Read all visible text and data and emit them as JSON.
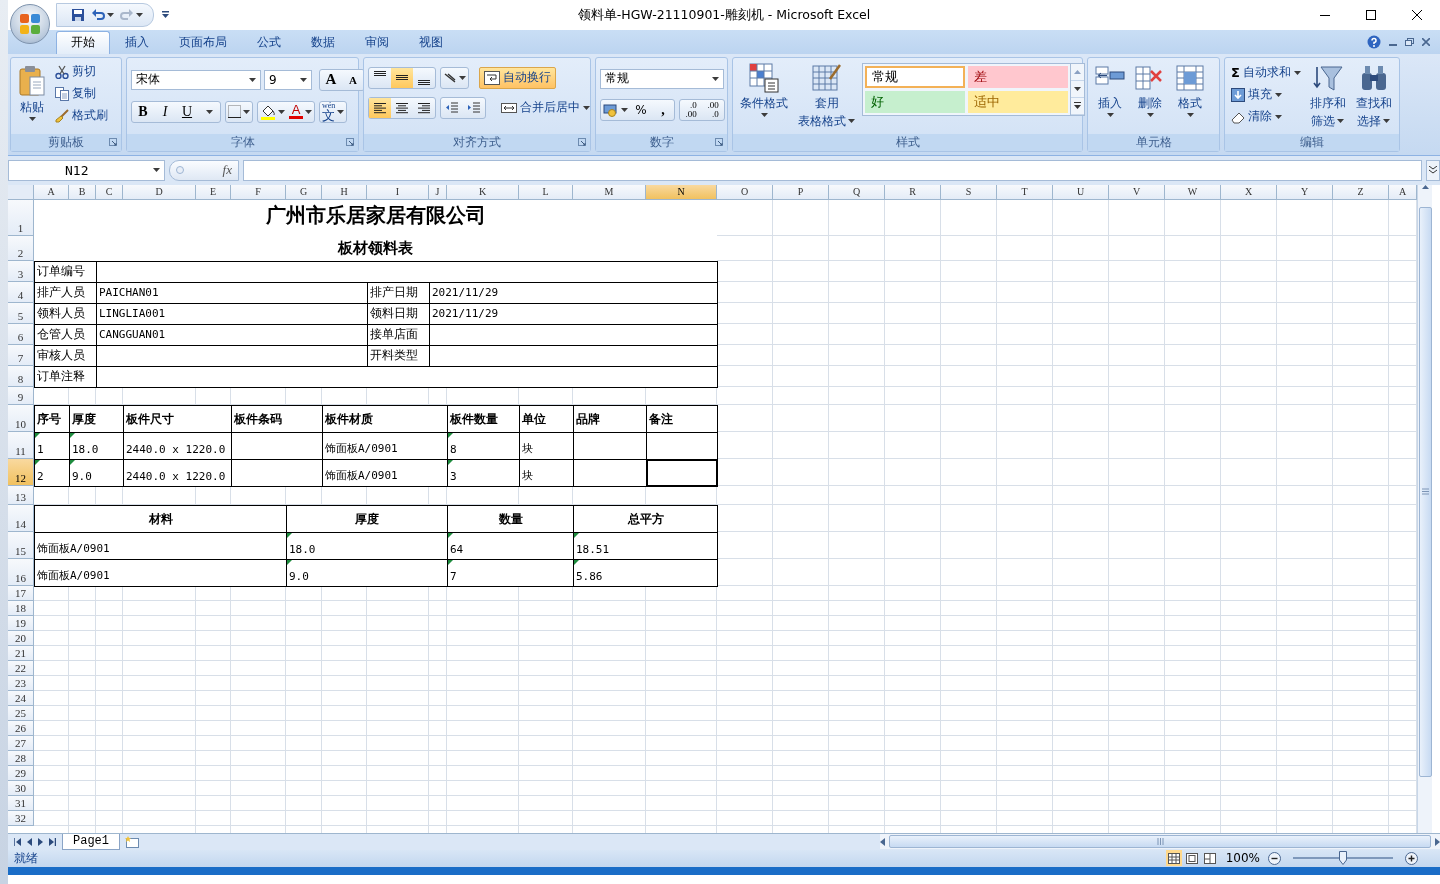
{
  "window": {
    "title": "领料单-HGW-21110901-雕刻机 - Microsoft Excel"
  },
  "tabs": [
    {
      "label": "开始",
      "selected": true
    },
    {
      "label": "插入",
      "selected": false
    },
    {
      "label": "页面布局",
      "selected": false
    },
    {
      "label": "公式",
      "selected": false
    },
    {
      "label": "数据",
      "selected": false
    },
    {
      "label": "审阅",
      "selected": false
    },
    {
      "label": "视图",
      "selected": false
    }
  ],
  "ribbon": {
    "clipboard": {
      "label": "剪贴板",
      "paste": "粘贴",
      "cut": "剪切",
      "copy": "复制",
      "format_painter": "格式刷"
    },
    "font": {
      "label": "字体",
      "font_name": "宋体",
      "font_size": "9",
      "grow": "A",
      "shrink": "A",
      "bold": "B",
      "italic": "I",
      "underline": "U",
      "font_color": "A",
      "phonetic_top": "wén",
      "phonetic": "文"
    },
    "alignment": {
      "label": "对齐方式",
      "vertical": [
        {
          "selected": false
        },
        {
          "selected": true
        },
        {
          "selected": false
        }
      ],
      "horizontal": [
        {
          "selected": true
        },
        {
          "selected": false
        },
        {
          "selected": false
        }
      ],
      "wrap_text": {
        "label": "自动换行",
        "selected": true
      },
      "merge": "合并后居中"
    },
    "number": {
      "label": "数字",
      "format": "常规",
      "percent": "%",
      "comma": ",",
      "decimal_increase": [
        ".0",
        ".00"
      ],
      "decimal_decrease": [
        ".00",
        ".0"
      ]
    },
    "styles": {
      "label": "样式",
      "conditional": "条件格式",
      "table_format": [
        "套用",
        "表格格式"
      ],
      "cell_styles": [
        {
          "text": "常规",
          "kind": "normal",
          "selected": true
        },
        {
          "text": "差",
          "kind": "bad",
          "selected": false
        },
        {
          "text": "好",
          "kind": "good",
          "selected": false
        },
        {
          "text": "适中",
          "kind": "neutral",
          "selected": false
        }
      ]
    },
    "cells": {
      "label": "单元格",
      "insert": "插入",
      "delete": "删除",
      "format": "格式"
    },
    "editing": {
      "label": "编辑",
      "autosum_symbol": "Σ",
      "autosum": "自动求和",
      "fill": "填充",
      "clear": "清除",
      "sort_filter": [
        "排序和",
        "筛选"
      ],
      "find_select": [
        "查找和",
        "选择"
      ]
    }
  },
  "formula_bar": {
    "name_box": "N12",
    "function_label": "fx"
  },
  "columns": [
    {
      "label": "A",
      "selected": false
    },
    {
      "label": "B",
      "selected": false
    },
    {
      "label": "C",
      "selected": false
    },
    {
      "label": "D",
      "selected": false
    },
    {
      "label": "E",
      "selected": false
    },
    {
      "label": "F",
      "selected": false
    },
    {
      "label": "G",
      "selected": false
    },
    {
      "label": "H",
      "selected": false
    },
    {
      "label": "I",
      "selected": false
    },
    {
      "label": "J",
      "selected": false
    },
    {
      "label": "K",
      "selected": false
    },
    {
      "label": "L",
      "selected": false
    },
    {
      "label": "M",
      "selected": false
    },
    {
      "label": "N",
      "selected": true
    },
    {
      "label": "O",
      "selected": false
    },
    {
      "label": "P",
      "selected": false
    },
    {
      "label": "Q",
      "selected": false
    },
    {
      "label": "R",
      "selected": false
    },
    {
      "label": "S",
      "selected": false
    },
    {
      "label": "T",
      "selected": false
    },
    {
      "label": "U",
      "selected": false
    },
    {
      "label": "V",
      "selected": false
    },
    {
      "label": "W",
      "selected": false
    },
    {
      "label": "X",
      "selected": false
    },
    {
      "label": "Y",
      "selected": false
    },
    {
      "label": "Z",
      "selected": false
    },
    {
      "label": "A",
      "selected": false
    }
  ],
  "rows": [
    {
      "label": "1",
      "selected": false
    },
    {
      "label": "2",
      "selected": false
    },
    {
      "label": "3",
      "selected": false
    },
    {
      "label": "4",
      "selected": false
    },
    {
      "label": "5",
      "selected": false
    },
    {
      "label": "6",
      "selected": false
    },
    {
      "label": "7",
      "selected": false
    },
    {
      "label": "8",
      "selected": false
    },
    {
      "label": "9",
      "selected": false
    },
    {
      "label": "10",
      "selected": false
    },
    {
      "label": "11",
      "selected": false
    },
    {
      "label": "12",
      "selected": true
    },
    {
      "label": "13",
      "selected": false
    },
    {
      "label": "14",
      "selected": false
    },
    {
      "label": "15",
      "selected": false
    },
    {
      "label": "16",
      "selected": false
    },
    {
      "label": "17",
      "selected": false
    },
    {
      "label": "18",
      "selected": false
    },
    {
      "label": "19",
      "selected": false
    },
    {
      "label": "20",
      "selected": false
    },
    {
      "label": "21",
      "selected": false
    },
    {
      "label": "22",
      "selected": false
    },
    {
      "label": "23",
      "selected": false
    },
    {
      "label": "24",
      "selected": false
    },
    {
      "label": "25",
      "selected": false
    },
    {
      "label": "26",
      "selected": false
    },
    {
      "label": "27",
      "selected": false
    },
    {
      "label": "28",
      "selected": false
    },
    {
      "label": "29",
      "selected": false
    },
    {
      "label": "30",
      "selected": false
    },
    {
      "label": "31",
      "selected": false
    },
    {
      "label": "32",
      "selected": false
    }
  ],
  "sheet": {
    "title": "广州市乐居家居有限公司",
    "subtitle": "板材领料表",
    "info": [
      {
        "label": "订单编号"
      },
      {
        "label": "排产人员",
        "value": "PAICHAN01",
        "label2": "排产日期",
        "value2": "2021/11/29"
      },
      {
        "label": "领料人员",
        "value": "LINGLIA001",
        "label2": "领料日期",
        "value2": "2021/11/29"
      },
      {
        "label": "仓管人员",
        "value": "CANGGUAN01",
        "label2": "接单店面"
      },
      {
        "label": "审核人员",
        "label2": "开料类型"
      },
      {
        "label": "订单注释"
      }
    ],
    "items": {
      "columns": [
        "序号",
        "厚度",
        "板件尺寸",
        "板件条码",
        "板件材质",
        "板件数量",
        "单位",
        "品牌",
        "备注"
      ],
      "rows": [
        [
          {
            "text": "1",
            "flag": true
          },
          {
            "text": "18.0",
            "flag": true
          },
          {
            "text": "2440.0 x 1220.0",
            "flag": false
          },
          {},
          {
            "text": "饰面板A/0901",
            "flag": false
          },
          {
            "text": "8",
            "flag": true
          },
          {
            "text": "块",
            "flag": false
          },
          {},
          {}
        ],
        [
          {
            "text": "2",
            "flag": true
          },
          {
            "text": "9.0",
            "flag": true
          },
          {
            "text": "2440.0 x 1220.0",
            "flag": false
          },
          {},
          {
            "text": "饰面板A/0901",
            "flag": false
          },
          {
            "text": "3",
            "flag": true
          },
          {
            "text": "块",
            "flag": false
          },
          {},
          {}
        ]
      ]
    },
    "summary": {
      "columns": [
        "材料",
        "厚度",
        "数量",
        "总平方"
      ],
      "rows": [
        [
          {
            "text": "饰面板A/0901",
            "flag": false
          },
          {
            "text": "18.0",
            "flag": true
          },
          {
            "text": "64",
            "flag": true
          },
          {
            "text": "18.51",
            "flag": true
          }
        ],
        [
          {
            "text": "饰面板A/0901",
            "flag": false
          },
          {
            "text": "9.0",
            "flag": true
          },
          {
            "text": "7",
            "flag": true
          },
          {
            "text": "5.86",
            "flag": true
          }
        ]
      ]
    }
  },
  "sheet_tabs": [
    {
      "label": "Page1",
      "selected": true
    }
  ],
  "status_bar": {
    "status": "就绪",
    "zoom": "100%",
    "zoom_slider": {
      "level": 0.5
    }
  }
}
